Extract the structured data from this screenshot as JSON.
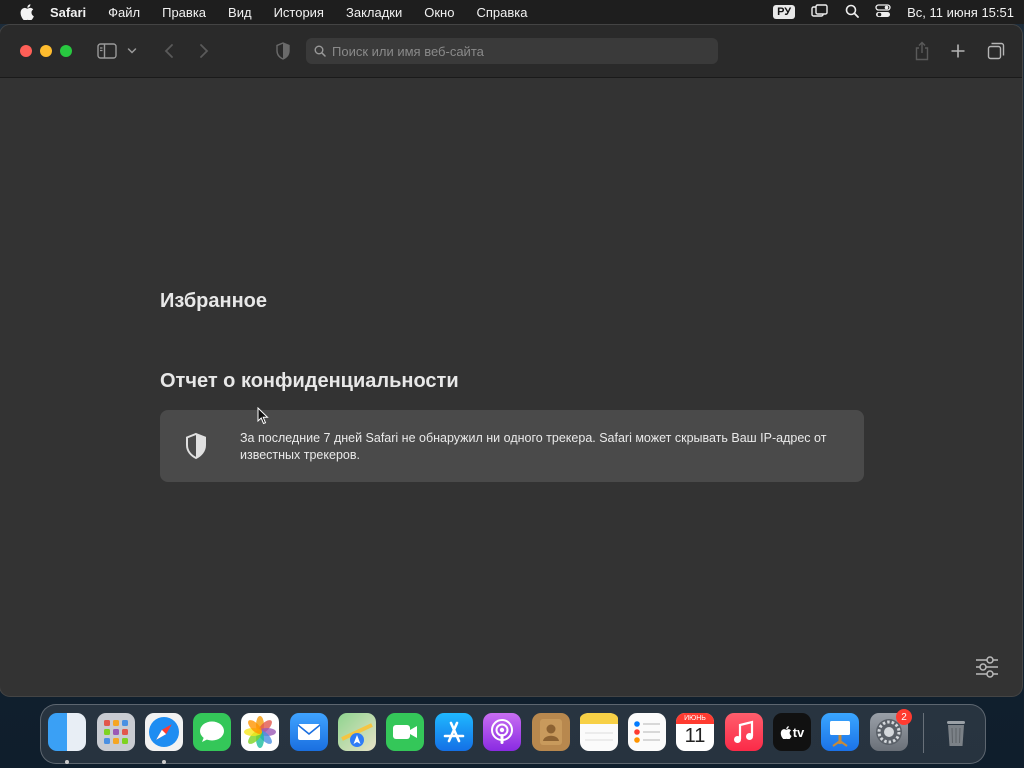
{
  "menubar": {
    "app_name": "Safari",
    "items": [
      "Файл",
      "Правка",
      "Вид",
      "История",
      "Закладки",
      "Окно",
      "Справка"
    ],
    "input_language": "РУ",
    "datetime": "Вс, 11 июня  15:51"
  },
  "toolbar": {
    "search_placeholder": "Поиск или имя веб-сайта"
  },
  "page": {
    "favorites_heading": "Избранное",
    "privacy_heading": "Отчет о конфиденциальности",
    "privacy_text": "За последние 7 дней Safari не обнаружил ни одного трекера. Safari может скрывать Ваш IP-адрес от известных трекеров."
  },
  "dock": {
    "apps": [
      "Finder",
      "Launchpad",
      "Safari",
      "Сообщения",
      "Фото",
      "Почта",
      "Карты",
      "FaceTime",
      "App Store",
      "Подкасты",
      "Контакты",
      "Заметки",
      "Напоминания",
      "Календарь",
      "Музыка",
      "TV",
      "Keynote",
      "Системные настройки",
      "Корзина"
    ],
    "calendar_month": "ИЮНЬ",
    "calendar_day": "11",
    "settings_badge": "2",
    "tv_label": "tv"
  },
  "colors": {
    "close": "#fe5f57",
    "minimize": "#febc2e",
    "zoom": "#28c840",
    "page_background": "#333333",
    "card_background": "#4a4a4a"
  }
}
